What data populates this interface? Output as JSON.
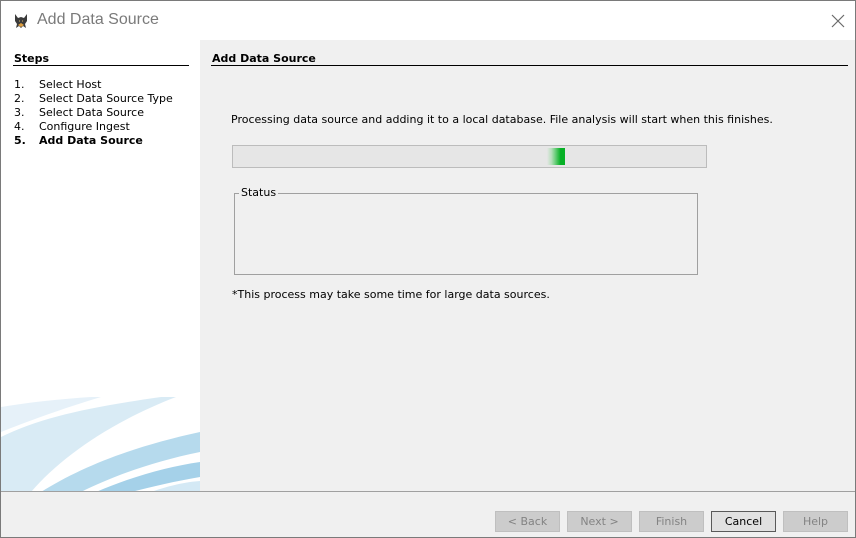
{
  "window": {
    "title": "Add Data Source",
    "icons": {
      "app": "autopsy-dog-icon",
      "close": "close-icon"
    }
  },
  "sidebar": {
    "title": "Steps",
    "steps": [
      {
        "num": "1.",
        "label": "Select Host"
      },
      {
        "num": "2.",
        "label": "Select Data Source Type"
      },
      {
        "num": "3.",
        "label": "Select Data Source"
      },
      {
        "num": "4.",
        "label": "Configure Ingest"
      },
      {
        "num": "5.",
        "label": "Add Data Source"
      }
    ],
    "current_step": 5
  },
  "panel": {
    "title": "Add Data Source",
    "message": "Processing data source and adding it to a local database. File analysis will start when this finishes.",
    "progress": {
      "indeterminate": true,
      "position": 0.69,
      "color": "#06b025"
    },
    "status_label": "Status",
    "note": "*This process may take some time for large data sources."
  },
  "buttons": {
    "back": "< Back",
    "next": "Next >",
    "finish": "Finish",
    "cancel": "Cancel",
    "help": "Help"
  },
  "colors": {
    "title_text": "#7a7a7a",
    "progress_green": "#06b025",
    "swoosh_blue": "#a9d3ea"
  }
}
